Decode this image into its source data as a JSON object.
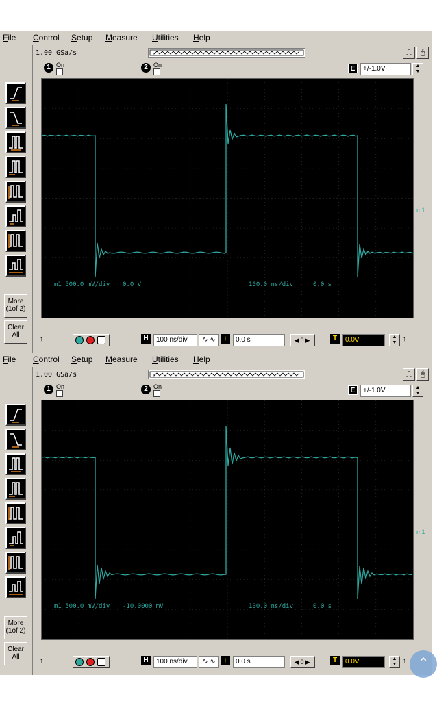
{
  "menu": [
    "File",
    "Control",
    "Setup",
    "Measure",
    "Utilities",
    "Help"
  ],
  "toolbar": {
    "more_label": "More\n(1of 2)",
    "more_line1": "More",
    "more_line2": "(1of 2)",
    "clear_line1": "Clear",
    "clear_line2": "All",
    "tools": [
      "rising-edge-trigger",
      "falling-edge-trigger",
      "pulse-width-trigger",
      "pulse-width-trigger-2",
      "glitch-trigger",
      "runt-trigger",
      "pattern-trigger",
      "state-trigger"
    ]
  },
  "scopes": [
    {
      "sample_rate": "1.00 GSa/s",
      "channel1": {
        "number": "1",
        "on_label": "On"
      },
      "channel2": {
        "number": "2",
        "on_label": "On"
      },
      "range_button": "E",
      "range_value": "+/-1.0V",
      "screen": {
        "m1_label": "m1 500.0 mV/div",
        "m1_offset": "0.0 V",
        "timebase_label": "100.0 ns/div",
        "time_offset": "0.0 s",
        "marker": "m1"
      },
      "status": {
        "h_button": "H",
        "timebase": "100 ns/div",
        "delay": "0.0 s",
        "t_button": "T",
        "trigger_level": "0.0V"
      }
    },
    {
      "sample_rate": "1.00 GSa/s",
      "channel1": {
        "number": "1",
        "on_label": "On"
      },
      "channel2": {
        "number": "2",
        "on_label": "On"
      },
      "range_button": "E",
      "range_value": "+/-1.0V",
      "screen": {
        "m1_label": "m1 500.0 mV/div",
        "m1_offset": "-10.0000 mV",
        "timebase_label": "100.0 ns/div",
        "time_offset": "0.0 s",
        "marker": "m1"
      },
      "status": {
        "h_button": "H",
        "timebase": "100 ns/div",
        "delay": "0.0 s",
        "t_button": "T",
        "trigger_level": "0.0V"
      }
    }
  ],
  "colors": {
    "trace": "#2fa8a0",
    "screen_bg": "#000000",
    "chrome": "#d4d0c8",
    "trigger_yellow": "#ffd800"
  }
}
